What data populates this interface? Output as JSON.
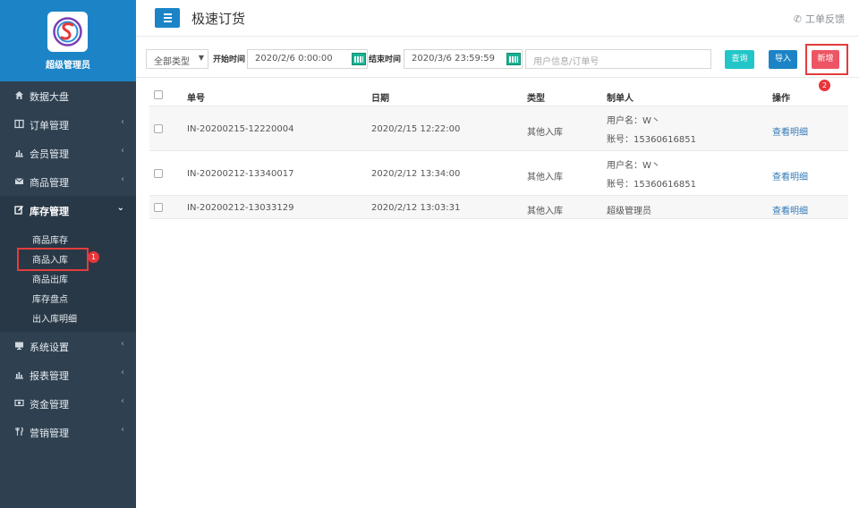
{
  "sidebar": {
    "brand_name": "超级管理员",
    "items": [
      {
        "label": "数据大盘",
        "icon": "home-icon"
      },
      {
        "label": "订单管理",
        "icon": "columns-icon"
      },
      {
        "label": "会员管理",
        "icon": "bar-chart-icon"
      },
      {
        "label": "商品管理",
        "icon": "envelope-icon"
      },
      {
        "label": "库存管理",
        "icon": "edit-icon",
        "expanded": true
      },
      {
        "label": "系统设置",
        "icon": "desktop-icon"
      },
      {
        "label": "报表管理",
        "icon": "bar-chart-icon"
      },
      {
        "label": "资金管理",
        "icon": "money-icon"
      },
      {
        "label": "营销管理",
        "icon": "cutlery-icon"
      }
    ],
    "subitems": [
      "商品库存",
      "商品入库",
      "商品出库",
      "库存盘点",
      "出入库明细"
    ],
    "badge_1": "1"
  },
  "header": {
    "title": "极速订货",
    "feedback": "工单反馈"
  },
  "filter": {
    "type_select": "全部类型",
    "start_label": "开始时间",
    "start_value": "2020/2/6 0:00:00",
    "end_label": "结束时间",
    "end_value": "2020/3/6 23:59:59",
    "search_placeholder": "用户信息/订单号",
    "query_btn": "查询",
    "import_btn": "导入",
    "new_btn": "新增",
    "badge_2": "2"
  },
  "table": {
    "headers": [
      "单号",
      "日期",
      "类型",
      "制单人",
      "操作"
    ],
    "rows": [
      {
        "order_no": "IN-20200215-12220004",
        "date": "2020/2/15 12:22:00",
        "type": "其他入库",
        "creator_user": "用户名：W丶",
        "creator_account": "账号：15360616851",
        "action": "查看明细"
      },
      {
        "order_no": "IN-20200212-13340017",
        "date": "2020/2/12 13:34:00",
        "type": "其他入库",
        "creator_user": "用户名：W丶",
        "creator_account": "账号：15360616851",
        "action": "查看明细"
      },
      {
        "order_no": "IN-20200212-13033129",
        "date": "2020/2/12 13:03:31",
        "type": "其他入库",
        "creator_user": "超级管理员",
        "action": "查看明细"
      }
    ]
  },
  "colors": {
    "sidebar_bg": "#2f4050",
    "brand_bg": "#1c84c6",
    "primary": "#1c84c6",
    "info": "#23c6c8",
    "danger": "#ed5565",
    "highlight_red": "#e23d3d"
  }
}
